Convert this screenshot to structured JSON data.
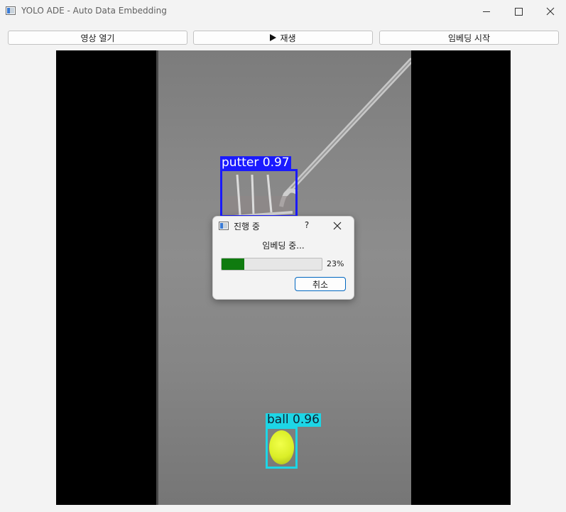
{
  "window": {
    "title": "YOLO ADE - Auto Data Embedding",
    "icon": "app-window-icon",
    "controls": [
      "minimize-icon",
      "maximize-icon",
      "close-icon"
    ]
  },
  "toolbar": {
    "open_label": "영상 열기",
    "play_label": "재생",
    "play_icon": "play-icon",
    "embed_label": "임베딩 시작"
  },
  "video": {
    "detections": [
      {
        "label": "putter",
        "confidence": "0.97",
        "text": "putter 0.97",
        "color": "#1a1aff"
      },
      {
        "label": "ball",
        "confidence": "0.96",
        "text": "ball 0.96",
        "color": "#1dd6e6"
      }
    ]
  },
  "dialog": {
    "title": "진행 중",
    "help": "?",
    "message": "임베딩 중...",
    "progress": 23,
    "progress_text": "23%",
    "cancel_label": "취소",
    "progress_color": "#0f7b0f"
  }
}
